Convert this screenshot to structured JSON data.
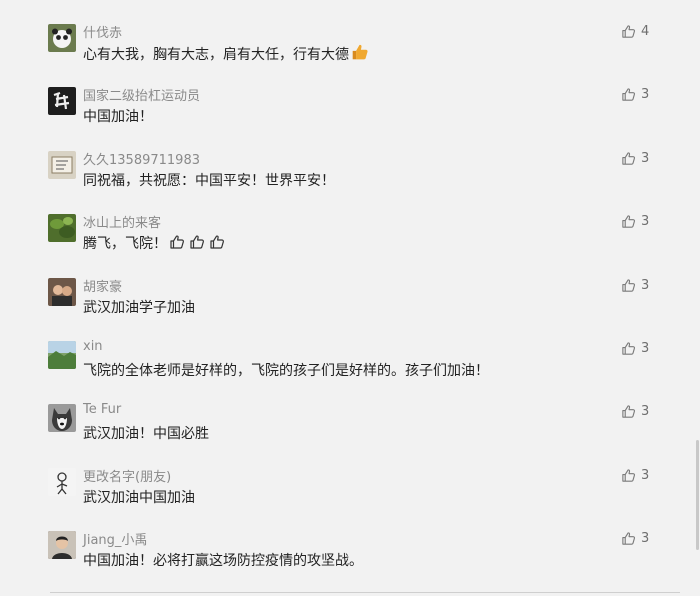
{
  "comments": [
    {
      "user": "什伐赤",
      "text": "心有大我，胸有大志，肩有大任，行有大德",
      "likes": "4",
      "avatar_icon": "panda-avatar-icon",
      "avatar_color": "#6b7b4e",
      "emoji": "thumbs-up-emoji",
      "outline_thumbs": 0
    },
    {
      "user": "国家二级抬杠运动员",
      "text": "中国加油！",
      "likes": "3",
      "avatar_icon": "calligraphy-avatar-icon",
      "avatar_color": "#1e1e1e",
      "emoji": null,
      "outline_thumbs": 0
    },
    {
      "user": "久久13589711983",
      "text": "同祝福，共祝愿：中国平安！世界平安！",
      "likes": "3",
      "avatar_icon": "scroll-avatar-icon",
      "avatar_color": "#d8d2c4",
      "emoji": null,
      "outline_thumbs": 0
    },
    {
      "user": "冰山上的来客",
      "text": "腾飞，飞院！",
      "likes": "3",
      "avatar_icon": "green-leaves-avatar-icon",
      "avatar_color": "#4f6e2c",
      "emoji": null,
      "outline_thumbs": 3
    },
    {
      "user": "胡家豪",
      "text": "武汉加油学子加油",
      "likes": "3",
      "avatar_icon": "couple-photo-avatar-icon",
      "avatar_color": "#6d5748",
      "emoji": null,
      "outline_thumbs": 0
    },
    {
      "user": "xin",
      "text": "飞院的全体老师是好样的，飞院的孩子们是好样的。孩子们加油！",
      "likes": "3",
      "avatar_icon": "landscape-avatar-icon",
      "avatar_color": "#7fa26a",
      "emoji": null,
      "outline_thumbs": 0
    },
    {
      "user": "Te Fur",
      "text": "武汉加油！中国必胜",
      "likes": "3",
      "avatar_icon": "husky-dog-avatar-icon",
      "avatar_color": "#9a9a9a",
      "emoji": null,
      "outline_thumbs": 0
    },
    {
      "user": "更改名字(朋友)",
      "text": "武汉加油中国加油",
      "likes": "3",
      "avatar_icon": "person-sketch-avatar-icon",
      "avatar_color": "#f4f4f4",
      "emoji": null,
      "outline_thumbs": 0
    },
    {
      "user": "Jiang_小禹",
      "text": "中国加油！必将打赢这场防控疫情的攻坚战。",
      "likes": "3",
      "avatar_icon": "portrait-avatar-icon",
      "avatar_color": "#5a4a3e",
      "emoji": null,
      "outline_thumbs": 0
    }
  ],
  "colors": {
    "background": "#f2f2f2",
    "username": "#8a8a8a",
    "text": "#222222",
    "like_icon": "#7a7a7a",
    "emoji": "#f0a830"
  },
  "icons": {
    "like": "thumbs-up-outline-icon"
  }
}
